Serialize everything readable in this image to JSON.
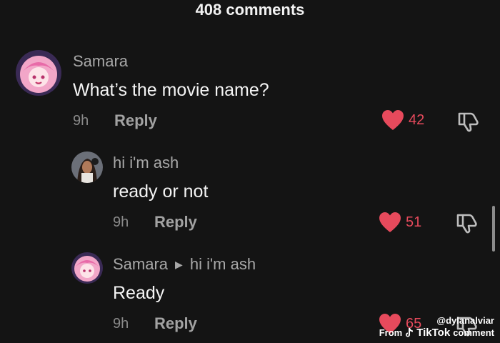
{
  "header": {
    "title": "408 comments"
  },
  "comments": [
    {
      "author": "Samara",
      "text": "What’s the movie name?",
      "time": "9h",
      "reply_label": "Reply",
      "likes": "42"
    },
    {
      "author": "hi i'm ash",
      "text": "ready or not",
      "time": "9h",
      "reply_label": "Reply",
      "likes": "51"
    },
    {
      "author": "Samara",
      "reply_to": "hi i'm ash",
      "text": "Ready",
      "time": "9h",
      "reply_label": "Reply",
      "likes": "65"
    }
  ],
  "watermark": {
    "handle": "@dylanalviar",
    "prefix": "From",
    "brand": "TikTok",
    "suffix": "comment"
  },
  "colors": {
    "background": "#141414",
    "like_red": "#e64a5c"
  },
  "icons": {
    "like": "heart-icon",
    "dislike": "thumbs-down-icon",
    "reply_arrow": "triangle-right-icon",
    "brand": "tiktok-note-icon"
  }
}
